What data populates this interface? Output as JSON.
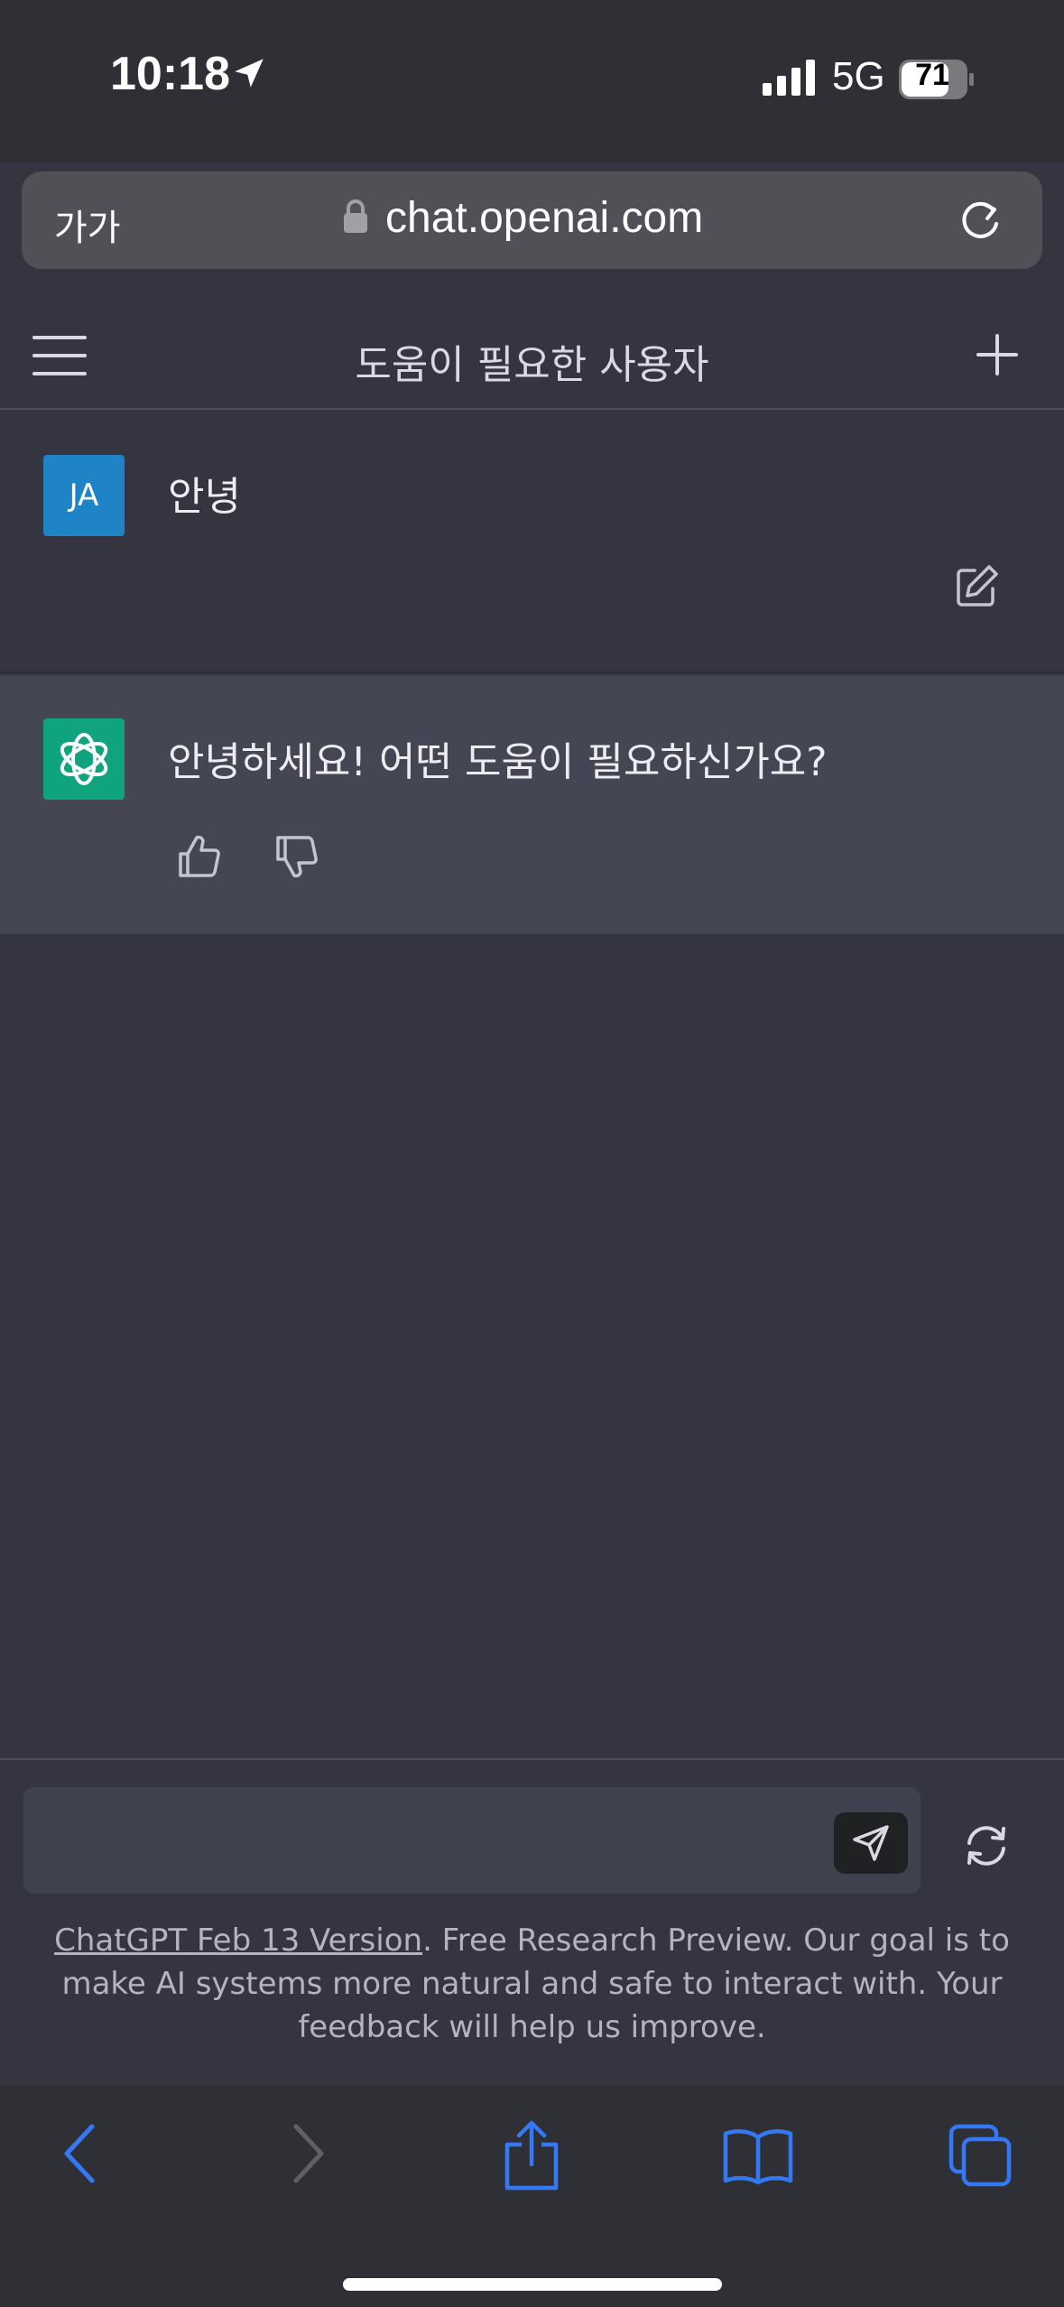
{
  "status_bar": {
    "time": "10:18",
    "network": "5G",
    "battery": "71"
  },
  "browser": {
    "text_size_label": "가가",
    "url": "chat.openai.com"
  },
  "nav": {
    "title": "도움이 필요한 사용자"
  },
  "conversation": {
    "user_initials": "JA",
    "user_message": "안녕",
    "assistant_message": "안녕하세요! 어떤 도움이 필요하신가요?"
  },
  "composer": {
    "placeholder": "",
    "disclaimer_link": "ChatGPT Feb 13 Version",
    "disclaimer_text": ". Free Research Preview. Our goal is to make AI systems more natural and safe to interact with. Your feedback will help us improve."
  },
  "colors": {
    "background": "#343541",
    "assistant_row": "#444654",
    "user_avatar": "#1f84c6",
    "assistant_avatar": "#10a37f",
    "safari_accent": "#3478f6"
  },
  "icons": {
    "status": [
      "location-arrow-icon",
      "signal-icon",
      "battery-icon"
    ],
    "browser": [
      "lock-icon",
      "reload-icon"
    ],
    "nav": [
      "menu-icon",
      "plus-icon"
    ],
    "message": [
      "edit-icon",
      "openai-logo-icon",
      "thumbs-up-icon",
      "thumbs-down-icon"
    ],
    "composer": [
      "send-icon",
      "regenerate-icon"
    ],
    "toolbar": [
      "back-icon",
      "forward-icon",
      "share-icon",
      "bookmarks-icon",
      "tabs-icon"
    ]
  }
}
